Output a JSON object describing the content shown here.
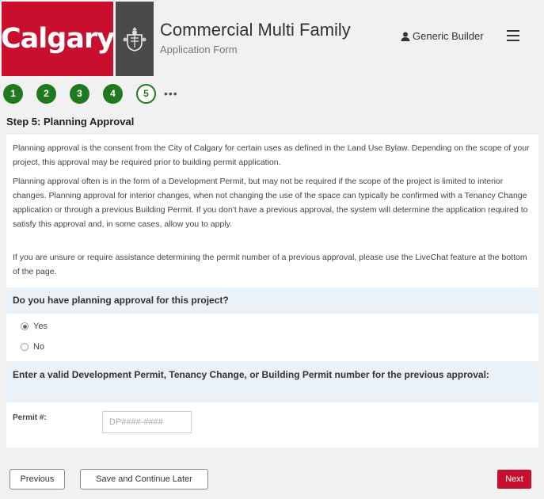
{
  "header": {
    "logo_text": "Calgary",
    "title": "Commercial Multi Family",
    "subtitle": "Application Form",
    "user_name": "Generic Builder",
    "icons": {
      "user": "user-icon",
      "menu": "hamburger-menu-icon",
      "crest": "city-crest-icon"
    }
  },
  "steps": {
    "items": [
      "1",
      "2",
      "3",
      "4",
      "5"
    ],
    "current": "5",
    "more": "•••"
  },
  "page": {
    "step_title": "Step 5: Planning Approval",
    "para1": "Planning approval is the consent from the City of Calgary for certain uses as defined in the Land Use Bylaw. Depending on the scope of your project, this approval may be required prior to building permit application.",
    "para2": "Planning approval often is in the form of a Development Permit, but may not be required if the scope of the project is limited to interior changes. Planning approval for interior changes, when not changing the use of the space can typically be confirmed with a Tenancy Change application or through a previous Building Permit. If you don't have a previous approval, the system will determine the application required to satisfy this approval and, in some cases, allow you to apply.",
    "para3": "If you are unsure or require assistance determining the permit number of a previous approval, please use the LiveChat feature at the bottom of the page.",
    "question": "Do you have planning approval for this project?",
    "options": [
      "Yes",
      "No"
    ],
    "selected": "Yes",
    "permit_question": "Enter a valid Development Permit, Tenancy Change, or Building Permit number for the previous approval:",
    "permit_label": "Permit #:",
    "permit_placeholder": "DP####-####",
    "permit_value": ""
  },
  "footer": {
    "previous": "Previous",
    "save": "Save and Continue Later",
    "next": "Next"
  },
  "colors": {
    "brand_red": "#c8102e",
    "step_green": "#1f7a1f",
    "question_bg": "#eaf1f7"
  }
}
